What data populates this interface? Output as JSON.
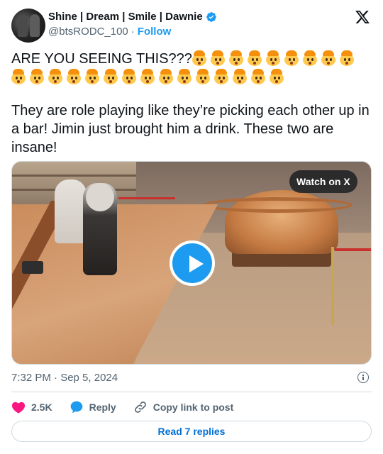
{
  "header": {
    "display_name": "Shine | Dream | Smile | Dawnie",
    "handle": "@btsRODC_100",
    "separator": "·",
    "follow_label": "Follow"
  },
  "tweet": {
    "headline": "ARE YOU SEEING THIS???",
    "emoji_count": 24,
    "emoji_name": "exploding-head-emoji",
    "body": "They are role playing like they’re picking each other up in a bar! Jimin just brought him a drink. These two are insane!"
  },
  "media": {
    "watch_label": "Watch on X",
    "play_icon": "play-icon"
  },
  "meta": {
    "timestamp": "7:32 PM · Sep 5, 2024"
  },
  "actions": {
    "like_count": "2.5K",
    "reply_label": "Reply",
    "copy_label": "Copy link to post"
  },
  "footer": {
    "read_replies_label": "Read 7 replies"
  },
  "colors": {
    "accent": "#1d9bf0",
    "heart": "#f91880",
    "text": "#0f1419",
    "secondary": "#536471",
    "link": "#006fd6"
  }
}
